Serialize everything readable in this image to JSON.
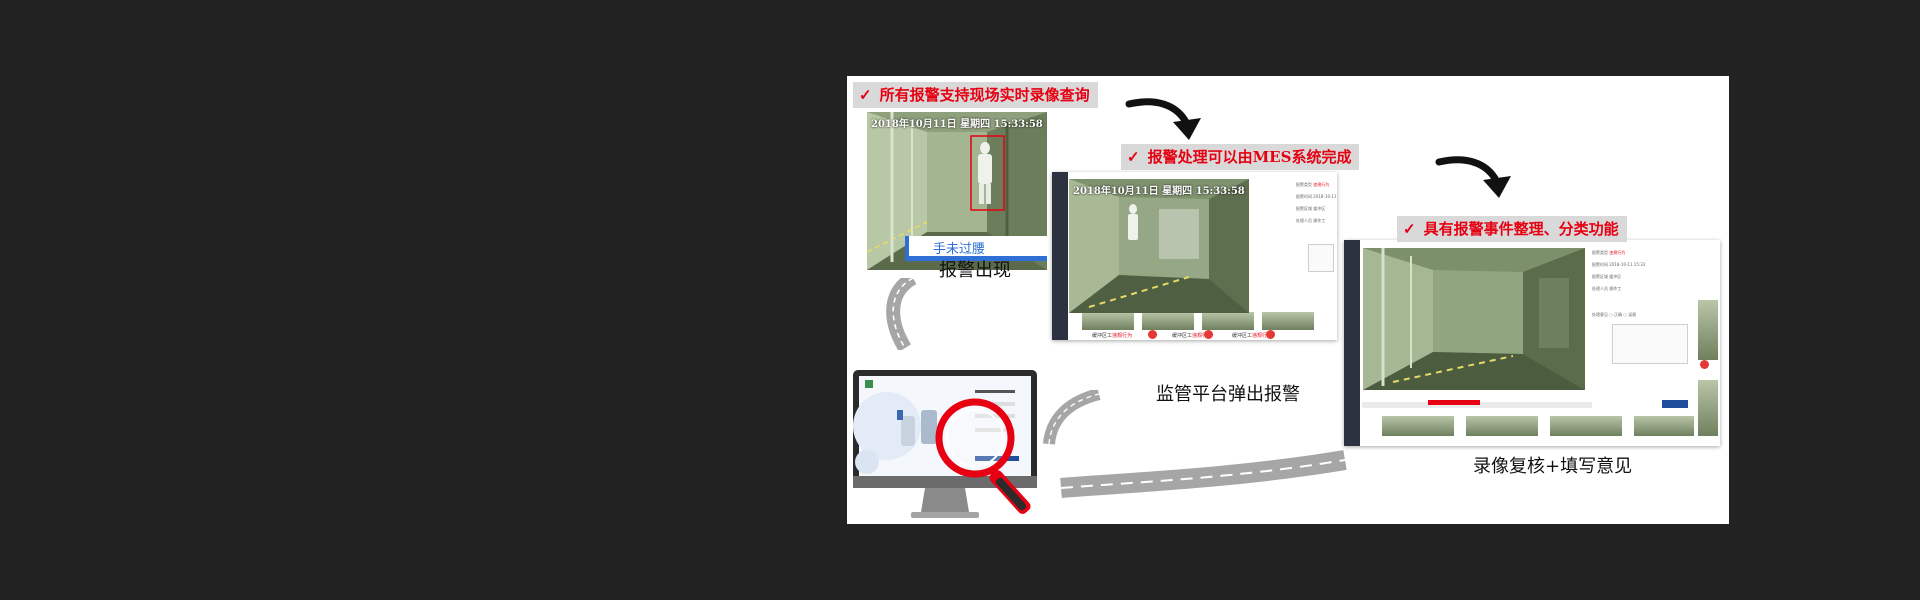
{
  "banners": {
    "b1": "所有报警支持现场实时录像查询",
    "b2": "报警处理可以由MES系统完成",
    "b3": "具有报警事件整理、分类功能",
    "check": "✓"
  },
  "captions": {
    "alarm_appears": "报警出现",
    "platform_popup": "监管平台弹出报警",
    "review": "录像复核+填写意见"
  },
  "cam1": {
    "timestamp": "2018年10月11日  星期四  15:33:58",
    "alarm_text": "手未过腰"
  },
  "cam2": {
    "timestamp": "2018年10月11日  星期四  15:33:58"
  },
  "thumbs": {
    "label_prefix": "缓冲区工",
    "label_alarm": "违规行为"
  },
  "colors": {
    "banner_text": "#e60012",
    "banner_bg": "#d9d9d9",
    "alarm_box": "#e60012",
    "alarm_label": "#2f6fd6",
    "road": "#a6a6a6",
    "arrow": "#111111"
  },
  "icons": [
    "check-icon",
    "curved-arrow-icon",
    "magnifier-icon",
    "monitor-icon",
    "road-icon"
  ]
}
